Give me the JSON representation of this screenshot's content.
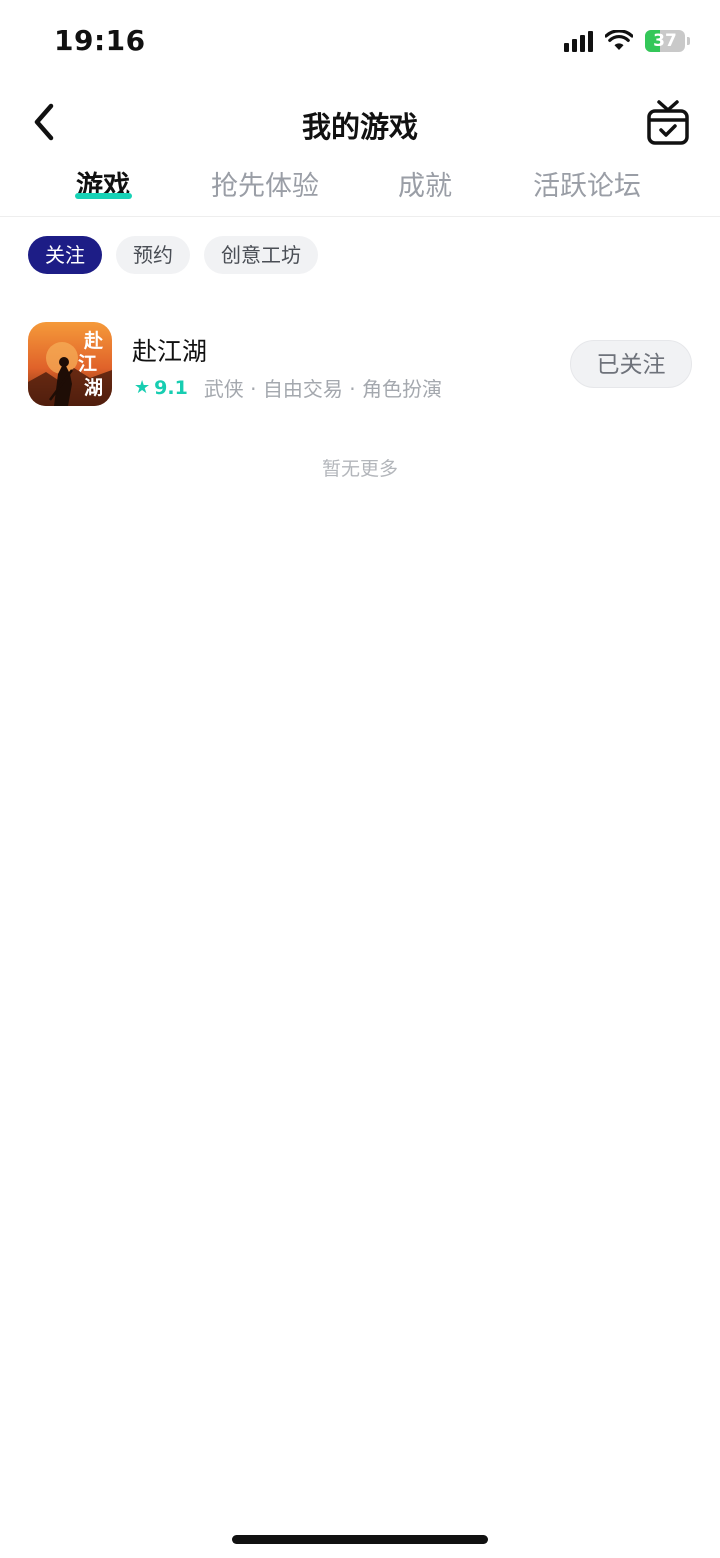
{
  "status_bar": {
    "time": "19:16",
    "battery": "37",
    "battery_level": 0.37,
    "icons": [
      "signal-icon",
      "wifi-icon",
      "battery-charging-icon"
    ]
  },
  "header": {
    "title": "我的游戏",
    "back_icon": "chevron-left-icon",
    "gift_icon": "gift-box-icon"
  },
  "tabs": [
    {
      "label": "游戏",
      "active": true
    },
    {
      "label": "抢先体验",
      "active": false
    },
    {
      "label": "成就",
      "active": false
    },
    {
      "label": "活跃论坛",
      "active": false
    }
  ],
  "filters": [
    {
      "label": "关注",
      "active": true
    },
    {
      "label": "预约",
      "active": false
    },
    {
      "label": "创意工坊",
      "active": false
    }
  ],
  "games": [
    {
      "title": "赴江湖",
      "rating": "9.1",
      "tags": "武侠 · 自由交易 · 角色扮演",
      "action": "已关注",
      "icon_text": "赴江湖"
    }
  ],
  "list_footer": "暂无更多",
  "colors": {
    "accent": "#17d2b6",
    "chip_active": "#1d1d86",
    "battery_green": "#34c759"
  }
}
